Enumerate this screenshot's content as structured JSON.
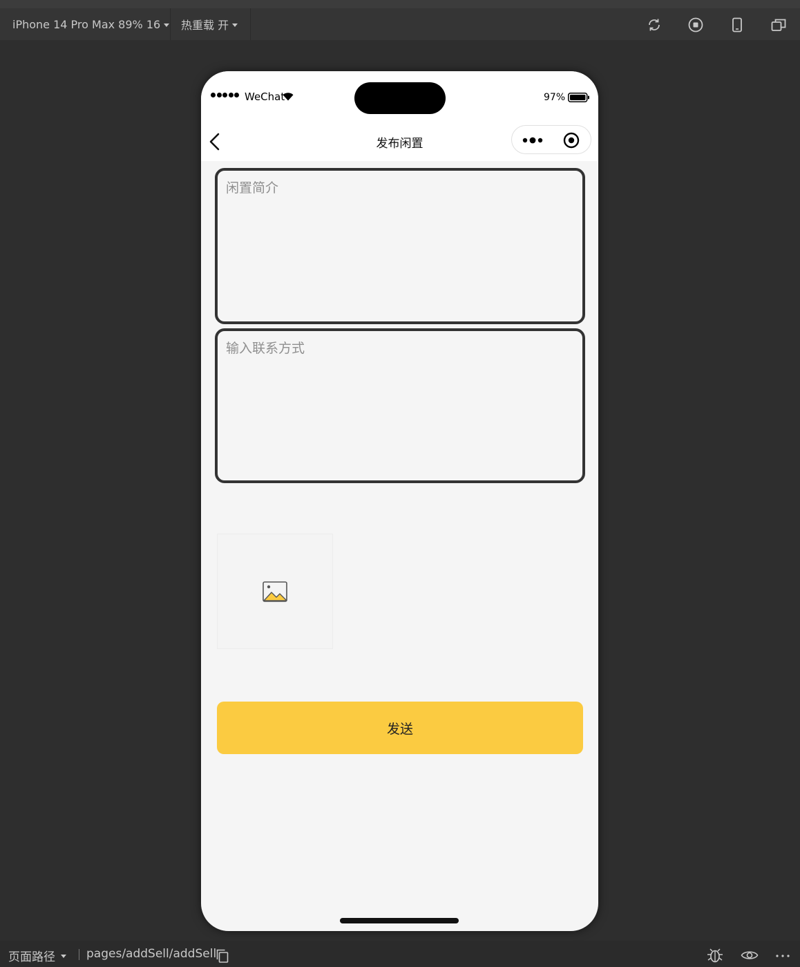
{
  "toolbar": {
    "device_label": "iPhone 14 Pro Max 89% 16",
    "hot_reload_label": "热重载 开"
  },
  "status_bar": {
    "carrier": "WeChat",
    "battery_percent": "97%"
  },
  "nav": {
    "title": "发布闲置"
  },
  "form": {
    "intro_placeholder": "闲置简介",
    "contact_placeholder": "输入联系方式",
    "upload_icon": "image-icon",
    "send_label": "发送"
  },
  "footer": {
    "page_path_label": "页面路径",
    "page_path": "pages/addSell/addSell"
  },
  "colors": {
    "accent": "#fbcb41",
    "page_background": "#f5f5f5",
    "field_border": "#333333"
  }
}
